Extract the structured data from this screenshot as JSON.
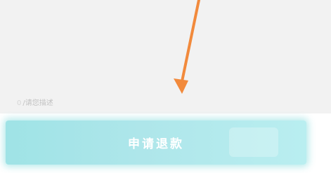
{
  "colors": {
    "panel_background": "#f2f2f2",
    "annotation_arrow": "#f28a3c",
    "button_background": "#a8e6ea",
    "button_text": "#ffffff",
    "counter_text": "#c2c2c2"
  },
  "form": {
    "char_counter_count": "0",
    "char_counter_hint": "/请您描述"
  },
  "submit": {
    "label": "申请退款"
  }
}
